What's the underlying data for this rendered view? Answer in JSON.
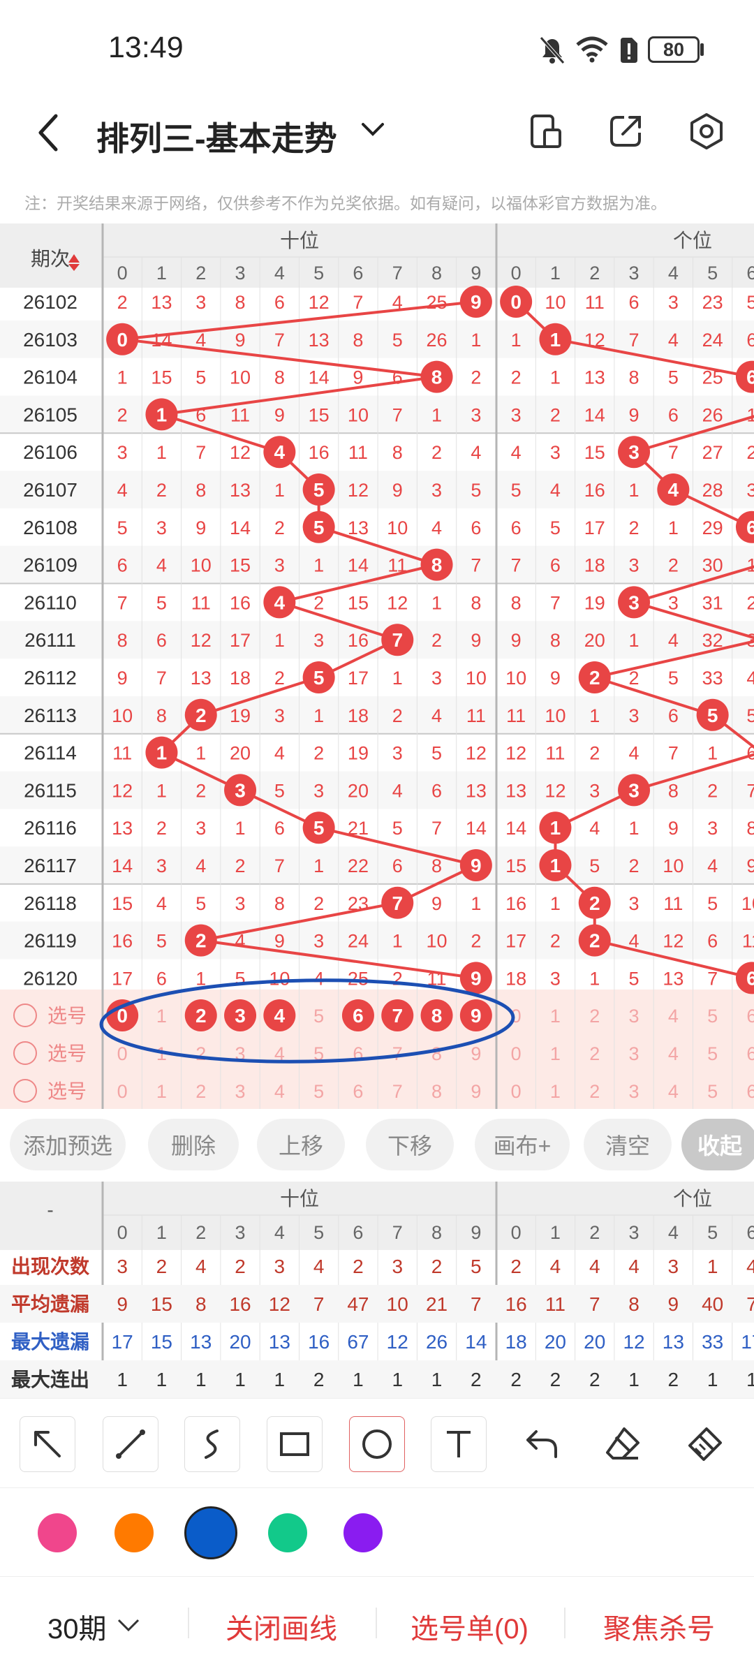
{
  "status_bar": {
    "time": "13:49",
    "battery": "80"
  },
  "header": {
    "title": "排列三-基本走势",
    "back_icon": "chevron-left-icon",
    "actions": [
      "phone-layout-icon",
      "share-icon",
      "settings-icon"
    ]
  },
  "notice": "注：开奖结果来源于网络，仅供参考不作为兑奖依据。如有疑问，以福体彩官方数据为准。",
  "grid": {
    "period_header": "期次",
    "ten_label": "十位",
    "one_label": "个位",
    "digits": [
      "0",
      "1",
      "2",
      "3",
      "4",
      "5",
      "6",
      "7",
      "8",
      "9"
    ],
    "one_digits_visible": [
      "0",
      "1",
      "2",
      "3",
      "4",
      "5",
      "6"
    ],
    "rows": [
      {
        "period": "26102",
        "ten": [
          "2",
          "13",
          "3",
          "8",
          "6",
          "12",
          "7",
          "4",
          "25",
          "9"
        ],
        "ten_hit": 9,
        "one": [
          "0",
          "10",
          "11",
          "6",
          "3",
          "23",
          "5"
        ],
        "one_hit": 0
      },
      {
        "period": "26103",
        "ten": [
          "0",
          "14",
          "4",
          "9",
          "7",
          "13",
          "8",
          "5",
          "26",
          "1"
        ],
        "ten_hit": 0,
        "one": [
          "1",
          "1",
          "12",
          "7",
          "4",
          "24",
          "6"
        ],
        "one_hit": 1
      },
      {
        "period": "26104",
        "ten": [
          "1",
          "15",
          "5",
          "10",
          "8",
          "14",
          "9",
          "6",
          "8",
          "2"
        ],
        "ten_hit": 8,
        "one": [
          "2",
          "1",
          "13",
          "8",
          "5",
          "25",
          "6"
        ],
        "one_hit": 6
      },
      {
        "period": "26105",
        "ten": [
          "2",
          "1",
          "6",
          "11",
          "9",
          "15",
          "10",
          "7",
          "1",
          "3"
        ],
        "ten_hit": 1,
        "one": [
          "3",
          "2",
          "14",
          "9",
          "6",
          "26",
          "1"
        ],
        "one_hit": -1
      },
      {
        "period": "26106",
        "ten": [
          "3",
          "1",
          "7",
          "12",
          "4",
          "16",
          "11",
          "8",
          "2",
          "4"
        ],
        "ten_hit": 4,
        "one": [
          "4",
          "3",
          "15",
          "3",
          "7",
          "27",
          "2"
        ],
        "one_hit": 3
      },
      {
        "period": "26107",
        "ten": [
          "4",
          "2",
          "8",
          "13",
          "1",
          "5",
          "12",
          "9",
          "3",
          "5"
        ],
        "ten_hit": 5,
        "one": [
          "5",
          "4",
          "16",
          "1",
          "4",
          "28",
          "3"
        ],
        "one_hit": 4
      },
      {
        "period": "26108",
        "ten": [
          "5",
          "3",
          "9",
          "14",
          "2",
          "5",
          "13",
          "10",
          "4",
          "6"
        ],
        "ten_hit": 5,
        "one": [
          "6",
          "5",
          "17",
          "2",
          "1",
          "29",
          "6"
        ],
        "one_hit": 6
      },
      {
        "period": "26109",
        "ten": [
          "6",
          "4",
          "10",
          "15",
          "3",
          "1",
          "14",
          "11",
          "8",
          "7"
        ],
        "ten_hit": 8,
        "one": [
          "7",
          "6",
          "18",
          "3",
          "2",
          "30",
          "1"
        ],
        "one_hit": -1
      },
      {
        "period": "26110",
        "ten": [
          "7",
          "5",
          "11",
          "16",
          "4",
          "2",
          "15",
          "12",
          "1",
          "8"
        ],
        "ten_hit": 4,
        "one": [
          "8",
          "7",
          "19",
          "3",
          "3",
          "31",
          "2"
        ],
        "one_hit": 3
      },
      {
        "period": "26111",
        "ten": [
          "8",
          "6",
          "12",
          "17",
          "1",
          "3",
          "16",
          "7",
          "2",
          "9"
        ],
        "ten_hit": 7,
        "one": [
          "9",
          "8",
          "20",
          "1",
          "4",
          "32",
          "3"
        ],
        "one_hit": -1
      },
      {
        "period": "26112",
        "ten": [
          "9",
          "7",
          "13",
          "18",
          "2",
          "5",
          "17",
          "1",
          "3",
          "10"
        ],
        "ten_hit": 5,
        "one": [
          "10",
          "9",
          "2",
          "2",
          "5",
          "33",
          "4"
        ],
        "one_hit": 2
      },
      {
        "period": "26113",
        "ten": [
          "10",
          "8",
          "2",
          "19",
          "3",
          "1",
          "18",
          "2",
          "4",
          "11"
        ],
        "ten_hit": 2,
        "one": [
          "11",
          "10",
          "1",
          "3",
          "6",
          "5",
          "5"
        ],
        "one_hit": 5
      },
      {
        "period": "26114",
        "ten": [
          "11",
          "1",
          "1",
          "20",
          "4",
          "2",
          "19",
          "3",
          "5",
          "12"
        ],
        "ten_hit": 1,
        "one": [
          "12",
          "11",
          "2",
          "4",
          "7",
          "1",
          "6"
        ],
        "one_hit": -1
      },
      {
        "period": "26115",
        "ten": [
          "12",
          "1",
          "2",
          "3",
          "5",
          "3",
          "20",
          "4",
          "6",
          "13"
        ],
        "ten_hit": 3,
        "one": [
          "13",
          "12",
          "3",
          "3",
          "8",
          "2",
          "7"
        ],
        "one_hit": 3
      },
      {
        "period": "26116",
        "ten": [
          "13",
          "2",
          "3",
          "1",
          "6",
          "5",
          "21",
          "5",
          "7",
          "14"
        ],
        "ten_hit": 5,
        "one": [
          "14",
          "1",
          "4",
          "1",
          "9",
          "3",
          "8"
        ],
        "one_hit": 1
      },
      {
        "period": "26117",
        "ten": [
          "14",
          "3",
          "4",
          "2",
          "7",
          "1",
          "22",
          "6",
          "8",
          "9"
        ],
        "ten_hit": 9,
        "one": [
          "15",
          "1",
          "5",
          "2",
          "10",
          "4",
          "9"
        ],
        "one_hit": 1
      },
      {
        "period": "26118",
        "ten": [
          "15",
          "4",
          "5",
          "3",
          "8",
          "2",
          "23",
          "7",
          "9",
          "1"
        ],
        "ten_hit": 7,
        "one": [
          "16",
          "1",
          "2",
          "3",
          "11",
          "5",
          "10"
        ],
        "one_hit": 2
      },
      {
        "period": "26119",
        "ten": [
          "16",
          "5",
          "2",
          "4",
          "9",
          "3",
          "24",
          "1",
          "10",
          "2"
        ],
        "ten_hit": 2,
        "one": [
          "17",
          "2",
          "2",
          "4",
          "12",
          "6",
          "11"
        ],
        "one_hit": 2
      },
      {
        "period": "26120",
        "ten": [
          "17",
          "6",
          "1",
          "5",
          "10",
          "4",
          "25",
          "2",
          "11",
          "9"
        ],
        "ten_hit": 9,
        "one": [
          "18",
          "3",
          "1",
          "5",
          "13",
          "7",
          "6"
        ],
        "one_hit": 6
      }
    ],
    "pick_label": "选号",
    "pick_selected_ten": [
      0,
      2,
      3,
      4,
      6,
      7,
      8,
      9
    ]
  },
  "actions": [
    "添加预选",
    "删除",
    "上移",
    "下移",
    "画布+",
    "清空",
    "收起"
  ],
  "stats": {
    "corner": "-",
    "ten_label": "十位",
    "one_label": "个位",
    "rows": [
      {
        "label": "出现次数",
        "ten": [
          "3",
          "2",
          "4",
          "2",
          "3",
          "4",
          "2",
          "3",
          "2",
          "5"
        ],
        "one": [
          "2",
          "4",
          "4",
          "4",
          "3",
          "1",
          "4"
        ],
        "color": "#c0392b"
      },
      {
        "label": "平均遗漏",
        "ten": [
          "9",
          "15",
          "8",
          "16",
          "12",
          "7",
          "47",
          "10",
          "21",
          "7"
        ],
        "one": [
          "16",
          "11",
          "7",
          "8",
          "9",
          "40",
          "7"
        ],
        "color": "#c0392b"
      },
      {
        "label": "最大遗漏",
        "ten": [
          "17",
          "15",
          "13",
          "20",
          "13",
          "16",
          "67",
          "12",
          "26",
          "14"
        ],
        "one": [
          "18",
          "20",
          "20",
          "12",
          "13",
          "33",
          "17"
        ],
        "color": "#2f5fc4"
      },
      {
        "label": "最大连出",
        "ten": [
          "1",
          "1",
          "1",
          "1",
          "1",
          "2",
          "1",
          "1",
          "1",
          "2"
        ],
        "one": [
          "2",
          "2",
          "2",
          "1",
          "2",
          "1",
          "1"
        ],
        "color": "#333"
      }
    ]
  },
  "tools": [
    "arrow-icon",
    "line-icon",
    "curve-icon",
    "rectangle-icon",
    "circle-icon",
    "text-icon",
    "undo-icon",
    "eraser-icon",
    "clear-brush-icon"
  ],
  "palette": [
    "#f0468c",
    "#ff7a00",
    "#0a5cc9",
    "#12c98a",
    "#8a1cf0"
  ],
  "bottom_bar": {
    "period_select": "30期",
    "close_draw": "关闭画线",
    "pick_list": "选号单(0)",
    "focus_kill": "聚焦杀号"
  }
}
